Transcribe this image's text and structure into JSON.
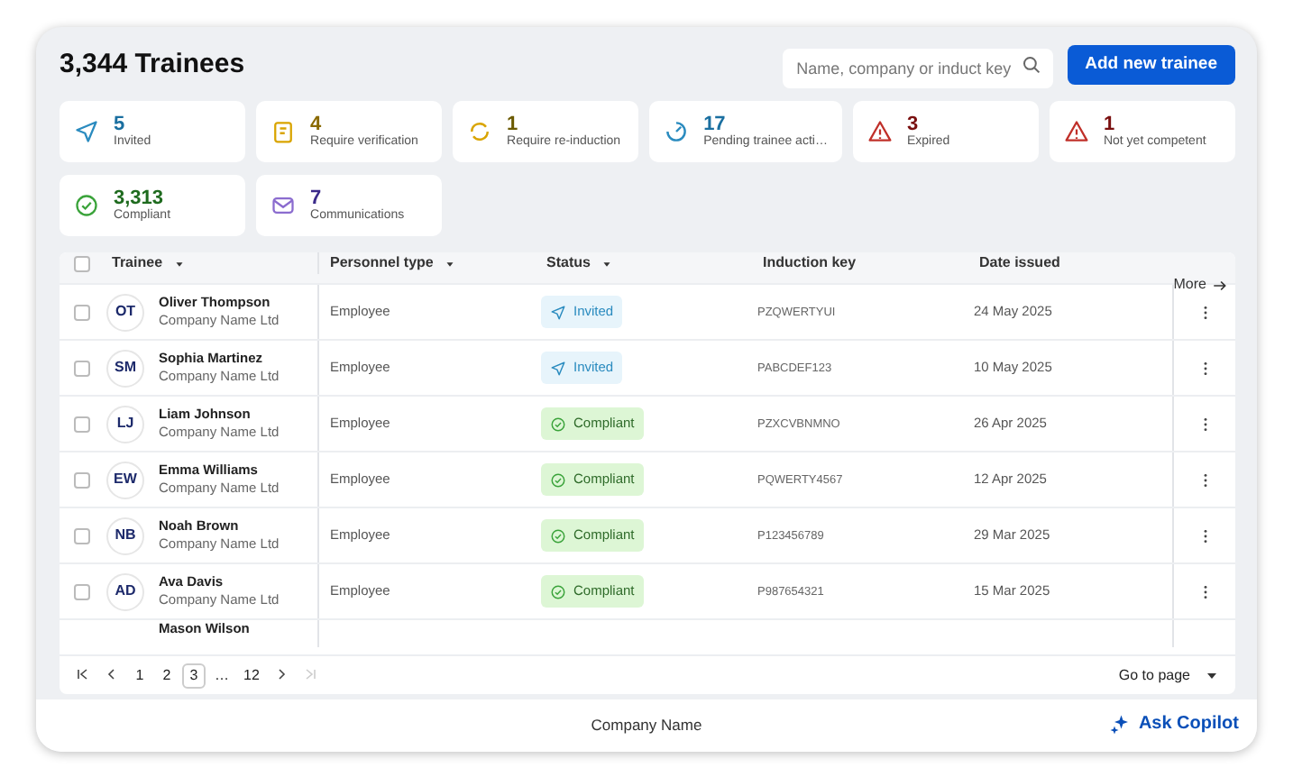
{
  "title": "3,344 Trainees",
  "search": {
    "placeholder": "Name, company or induct key"
  },
  "add_button": "Add new trainee",
  "stats": [
    {
      "kind": "invited",
      "value": "5",
      "label": "Invited",
      "color": "#1a6fa0"
    },
    {
      "kind": "verification",
      "value": "4",
      "label": "Require verification",
      "color": "#8a6a00"
    },
    {
      "kind": "reinduction",
      "value": "1",
      "label": "Require re-induction",
      "color": "#6b5a00"
    },
    {
      "kind": "pending",
      "value": "17",
      "label": "Pending trainee acti…",
      "color": "#1a6fa0"
    },
    {
      "kind": "expired",
      "value": "3",
      "label": "Expired",
      "color": "#7a1010"
    },
    {
      "kind": "notcompetent",
      "value": "1",
      "label": "Not yet competent",
      "color": "#7a1010"
    },
    {
      "kind": "compliant",
      "value": "3,313",
      "label": "Compliant",
      "color": "#1f6b1f"
    },
    {
      "kind": "communications",
      "value": "7",
      "label": "Communications",
      "color": "#3b2a8a"
    }
  ],
  "table": {
    "columns": [
      {
        "label": "Trainee",
        "sortable": true
      },
      {
        "label": "Personnel type",
        "sortable": true
      },
      {
        "label": "Status",
        "sortable": true
      },
      {
        "label": "Induction key",
        "sortable": false
      },
      {
        "label": "Date issued",
        "sortable": false
      }
    ],
    "more": "More",
    "rows": [
      {
        "initials": "OT",
        "name": "Oliver Thompson",
        "company": "Company Name Ltd",
        "type": "Employee",
        "status": {
          "kind": "invited",
          "label": "Invited"
        },
        "key": "PZQWERTYUI",
        "date": "24 May 2025",
        "checked": false
      },
      {
        "initials": "SM",
        "name": "Sophia Martinez",
        "company": "Company Name Ltd",
        "type": "Employee",
        "status": {
          "kind": "invited",
          "label": "Invited"
        },
        "key": "PABCDEF123",
        "date": "10 May 2025",
        "checked": false
      },
      {
        "initials": "LJ",
        "name": "Liam Johnson",
        "company": "Company Name Ltd",
        "type": "Employee",
        "status": {
          "kind": "compliant",
          "label": "Compliant"
        },
        "key": "PZXCVBNMNO",
        "date": "26 Apr 2025",
        "checked": false
      },
      {
        "initials": "EW",
        "name": "Emma Williams",
        "company": "Company Name Ltd",
        "type": "Employee",
        "status": {
          "kind": "compliant",
          "label": "Compliant"
        },
        "key": "PQWERTY4567",
        "date": "12 Apr 2025",
        "checked": false
      },
      {
        "initials": "NB",
        "name": "Noah Brown",
        "company": "Company Name Ltd",
        "type": "Employee",
        "status": {
          "kind": "compliant",
          "label": "Compliant"
        },
        "key": "P123456789",
        "date": "29 Mar 2025",
        "checked": false
      },
      {
        "initials": "AD",
        "name": "Ava Davis",
        "company": "Company Name Ltd",
        "type": "Employee",
        "status": {
          "kind": "compliant",
          "label": "Compliant"
        },
        "key": "P987654321",
        "date": "15 Mar 2025",
        "checked": false
      },
      {
        "name": "Mason Wilson"
      }
    ],
    "select_all_checked": false
  },
  "pagination": {
    "pages": [
      {
        "label": "1",
        "selected": false
      },
      {
        "label": "2",
        "selected": false
      },
      {
        "label": "3",
        "selected": true
      },
      {
        "label": "…",
        "selected": false
      },
      {
        "label": "12",
        "selected": false
      }
    ],
    "next_disabled": false,
    "last_disabled": true,
    "goto": "Go to page"
  },
  "footer": {
    "company": "Company Name",
    "copilot": "Ask Copilot"
  }
}
